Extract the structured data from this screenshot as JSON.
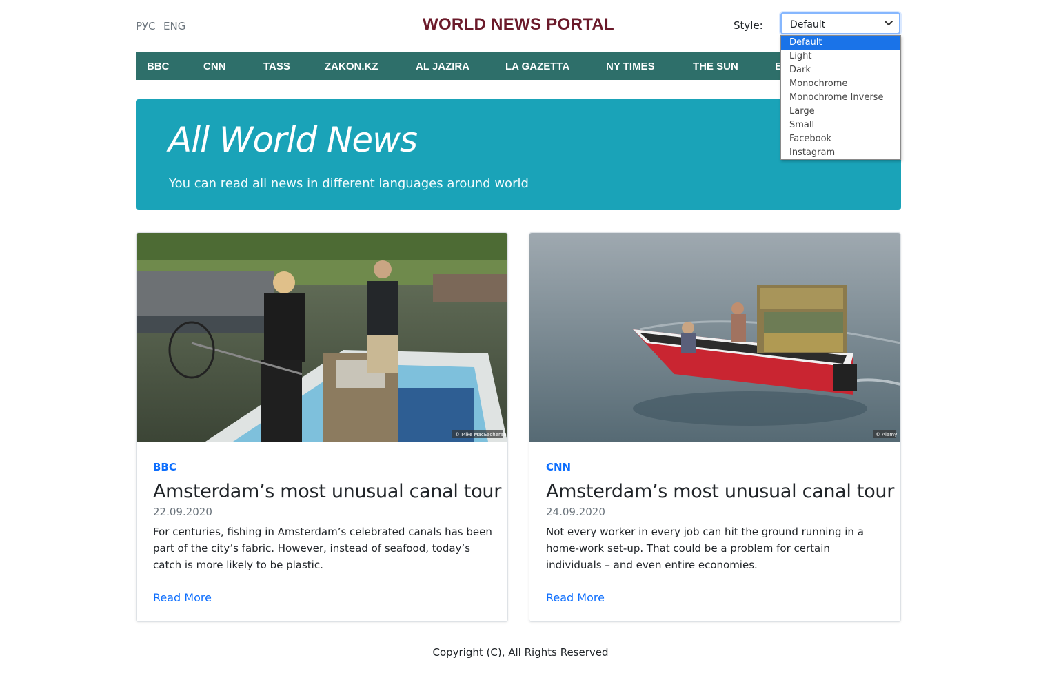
{
  "header": {
    "lang_ru": "РУС",
    "lang_en": "ENG",
    "brand": "WORLD NEWS PORTAL",
    "style_label": "Style:",
    "style_selected": "Default"
  },
  "style_options": [
    "Default",
    "Light",
    "Dark",
    "Monochrome",
    "Monochrome Inverse",
    "Large",
    "Small",
    "Facebook",
    "Instagram"
  ],
  "nav": [
    "BBC",
    "CNN",
    "TASS",
    "ZAKON.KZ",
    "AL JAZIRA",
    "LA GAZETTA",
    "NY TIMES",
    "THE SUN",
    "E"
  ],
  "hero": {
    "title": "All World News",
    "subtitle": "You can read all news in different languages around world"
  },
  "cards": [
    {
      "source": "BBC",
      "title": "Amsterdam’s most unusual canal tour",
      "date": "22.09.2020",
      "text": "For centuries, fishing in Amsterdam’s celebrated canals has been part of the city’s fabric. However, instead of seafood, today’s catch is more likely to be plastic.",
      "more": "Read More",
      "credit": "© Mike MacEacheran"
    },
    {
      "source": "CNN",
      "title": "Amsterdam’s most unusual canal tour",
      "date": "24.09.2020",
      "text": "Not every worker in every job can hit the ground running in a home-work set-up. That could be a problem for certain individuals – and even entire economies.",
      "more": "Read More",
      "credit": "© Alamy"
    }
  ],
  "footer": "Copyright (C), All Rights Reserved",
  "colors": {
    "brand": "#6b1a2a",
    "navbar": "#2e6f6a",
    "hero": "#1aa3b8",
    "link": "#0d6efd",
    "dropdown_selected": "#1a73e8"
  }
}
